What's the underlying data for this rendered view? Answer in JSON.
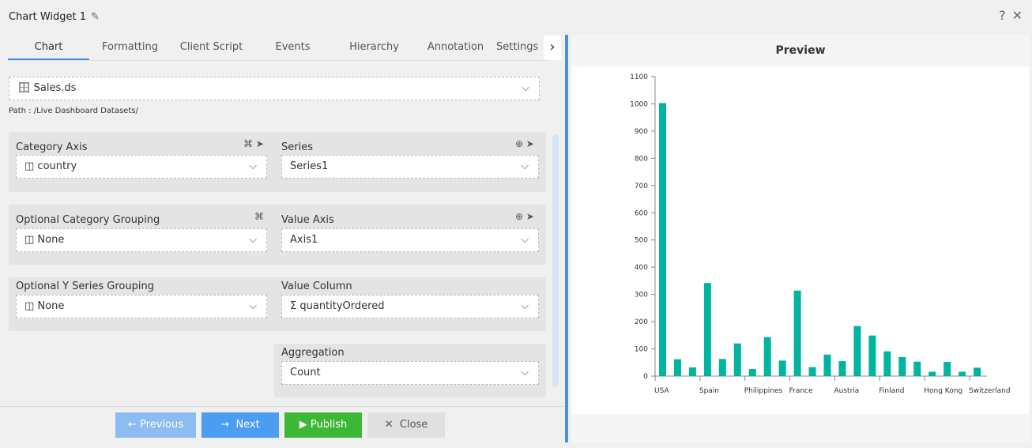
{
  "header": {
    "title": "Chart Widget 1",
    "help": "?",
    "close": "✕"
  },
  "tabs": [
    "Chart",
    "Formatting",
    "Client Script",
    "Events",
    "Hierarchy",
    "Annotation",
    "Settings"
  ],
  "dataset": {
    "value": "Sales.ds",
    "path": "Path : /Live Dashboard Datasets/"
  },
  "fields": {
    "category_axis": {
      "label": "Category Axis",
      "value": "country"
    },
    "series": {
      "label": "Series",
      "value": "Series1"
    },
    "opt_cat_group": {
      "label": "Optional Category Grouping",
      "value": "None"
    },
    "value_axis": {
      "label": "Value Axis",
      "value": "Axis1"
    },
    "opt_y_group": {
      "label": "Optional Y Series Grouping",
      "value": "None"
    },
    "value_column": {
      "label": "Value Column",
      "value": "quantityOrdered"
    },
    "aggregation": {
      "label": "Aggregation",
      "value": "Count"
    }
  },
  "buttons": {
    "previous": "Previous",
    "next": "Next",
    "publish": "Publish",
    "close": "Close"
  },
  "preview": {
    "title": "Preview"
  },
  "chart_data": {
    "type": "bar",
    "categories": [
      "USA",
      "",
      "",
      "Spain",
      "",
      "",
      "Philippines",
      "",
      "",
      "France",
      "",
      "",
      "Austria",
      "",
      "",
      "Finland",
      "",
      "",
      "Hong Kong",
      "",
      "",
      "Switzerland"
    ],
    "values": [
      1003,
      62,
      32,
      342,
      63,
      120,
      26,
      143,
      57,
      314,
      33,
      79,
      55,
      184,
      149,
      91,
      70,
      53,
      16,
      52,
      16,
      31
    ],
    "ylim": [
      0,
      1100
    ],
    "yticks": [
      0,
      100,
      200,
      300,
      400,
      500,
      600,
      700,
      800,
      900,
      1000,
      1100
    ],
    "color": "#00b4a0",
    "grid": false
  }
}
